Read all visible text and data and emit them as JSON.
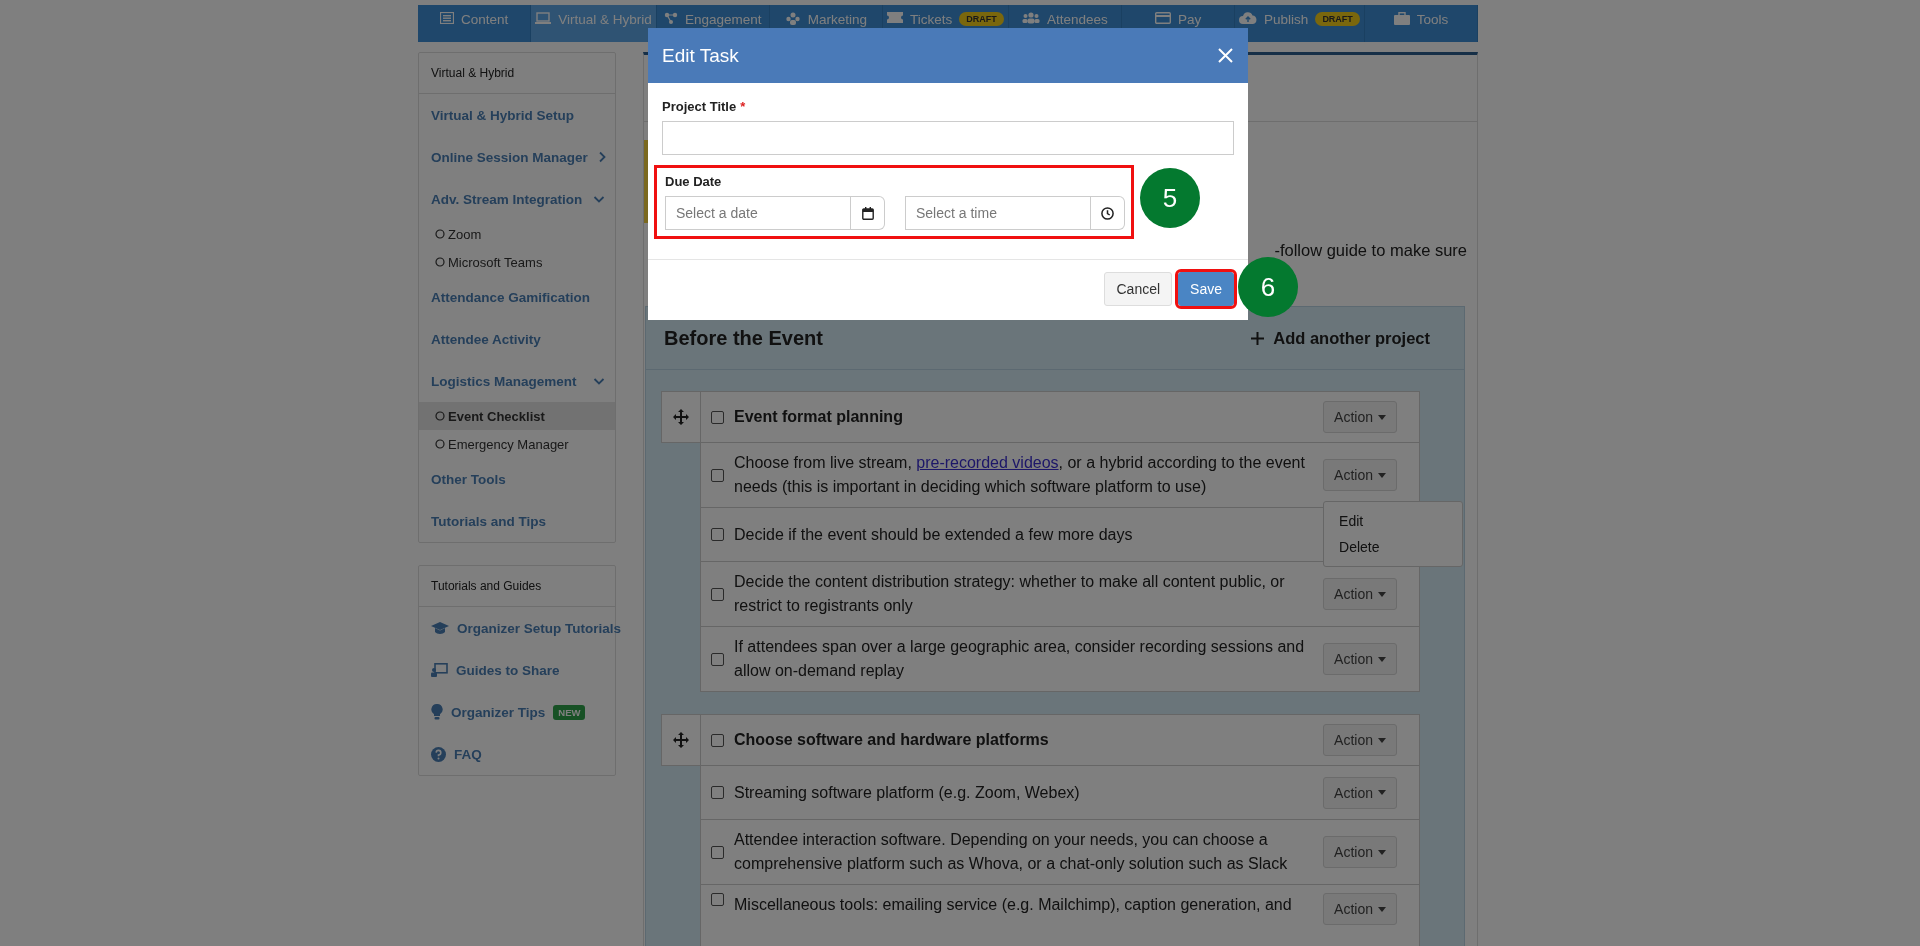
{
  "nav": {
    "tabs": [
      {
        "label": "Content",
        "selected": false
      },
      {
        "label": "Virtual & Hybrid",
        "selected": true
      },
      {
        "label": "Engagement",
        "selected": false
      },
      {
        "label": "Marketing",
        "selected": false
      },
      {
        "label": "Tickets",
        "badge": "DRAFT",
        "selected": false
      },
      {
        "label": "Attendees",
        "selected": false
      },
      {
        "label": "Pay",
        "selected": false
      },
      {
        "label": "Publish",
        "badge": "DRAFT",
        "selected": false
      },
      {
        "label": "Tools",
        "selected": false
      }
    ]
  },
  "sidebar": {
    "panels": [
      {
        "title": "Virtual & Hybrid",
        "items": [
          {
            "label": "Virtual & Hybrid Setup"
          },
          {
            "label": "Online Session Manager",
            "expanded": false
          },
          {
            "label": "Adv. Stream Integration",
            "expanded": true,
            "children": [
              {
                "label": "Zoom",
                "selected": false
              },
              {
                "label": "Microsoft Teams",
                "selected": false
              }
            ]
          },
          {
            "label": "Attendance Gamification"
          },
          {
            "label": "Attendee Activity"
          },
          {
            "label": "Logistics Management",
            "expanded": true,
            "children": [
              {
                "label": "Event Checklist",
                "selected": true
              },
              {
                "label": "Emergency Manager",
                "selected": false
              }
            ]
          },
          {
            "label": "Other Tools"
          },
          {
            "label": "Tutorials and Tips"
          }
        ]
      },
      {
        "title": "Tutorials and Guides",
        "items": [
          {
            "label": "Organizer Setup Tutorials"
          },
          {
            "label": "Guides to Share"
          },
          {
            "label": "Organizer Tips",
            "badge": "NEW"
          },
          {
            "label": "FAQ"
          }
        ]
      }
    ]
  },
  "main": {
    "intro": {
      "line1_end": "-follow guide to make sure"
    },
    "section": {
      "title": "Before the Event",
      "add_label": "Add another project",
      "projects": [
        {
          "title": "Event format planning",
          "checked": false,
          "action": "Action",
          "tasks": [
            {
              "text": "Choose from live stream, ",
              "link": "pre-recorded videos",
              "after": ", or a hybrid according to the event needs (this is important in deciding which software platform to use)",
              "checked": false,
              "action": "Action",
              "menu": [
                {
                  "label": "Edit"
                },
                {
                  "label": "Delete"
                }
              ]
            },
            {
              "text": "Decide if the event should be extended a few more days",
              "checked": false
            },
            {
              "text": "Decide the content distribution strategy: whether to make all content public, or restrict to registrants only",
              "checked": false,
              "action": "Action"
            },
            {
              "text": "If attendees span over a large geographic area, consider recording sessions and allow on-demand replay",
              "checked": false,
              "action": "Action"
            }
          ]
        },
        {
          "title": "Choose software and hardware platforms",
          "checked": false,
          "action": "Action",
          "tasks": [
            {
              "text": "Streaming software platform (e.g. Zoom, Webex)",
              "checked": false,
              "action": "Action"
            },
            {
              "text": "Attendee interaction software. Depending on your needs, you can choose a comprehensive platform such as Whova, or a chat-only solution such as Slack",
              "checked": false,
              "action": "Action"
            },
            {
              "text": "Miscellaneous tools: emailing service (e.g. Mailchimp), caption generation, and",
              "checked": false,
              "action": "Action"
            }
          ]
        }
      ]
    }
  },
  "modal": {
    "title": "Edit Task",
    "project_title": {
      "label": "Project Title",
      "required_mark": "*"
    },
    "due_date": {
      "label": "Due Date",
      "date_placeholder": "Select a date",
      "time_placeholder": "Select a time",
      "highlighted": true,
      "marker": "5"
    },
    "buttons": [
      {
        "label": "Cancel",
        "kind": "secondary"
      },
      {
        "label": "Save",
        "kind": "primary",
        "highlighted": true,
        "marker": "6"
      }
    ]
  }
}
